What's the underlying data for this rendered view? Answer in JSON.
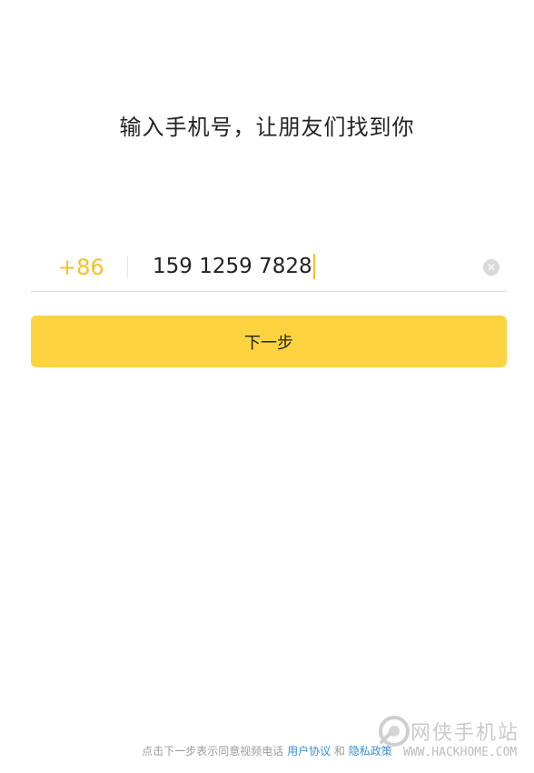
{
  "title": "输入手机号，让朋友们找到你",
  "phone": {
    "country_code": "+86",
    "value": "159 1259 7828",
    "clear_icon": "clear-circle-icon"
  },
  "next_button": {
    "label": "下一步"
  },
  "footer": {
    "prefix": "点击下一步表示同意视频电话",
    "user_agreement": "用户协议",
    "and": "和",
    "privacy_policy": "隐私政策"
  },
  "watermark": {
    "name": "网侠手机站",
    "url": "WWW.HACKHOME.COM"
  },
  "colors": {
    "accent": "#fdd33f",
    "country_code": "#f5c129",
    "link": "#3a8fd8"
  }
}
